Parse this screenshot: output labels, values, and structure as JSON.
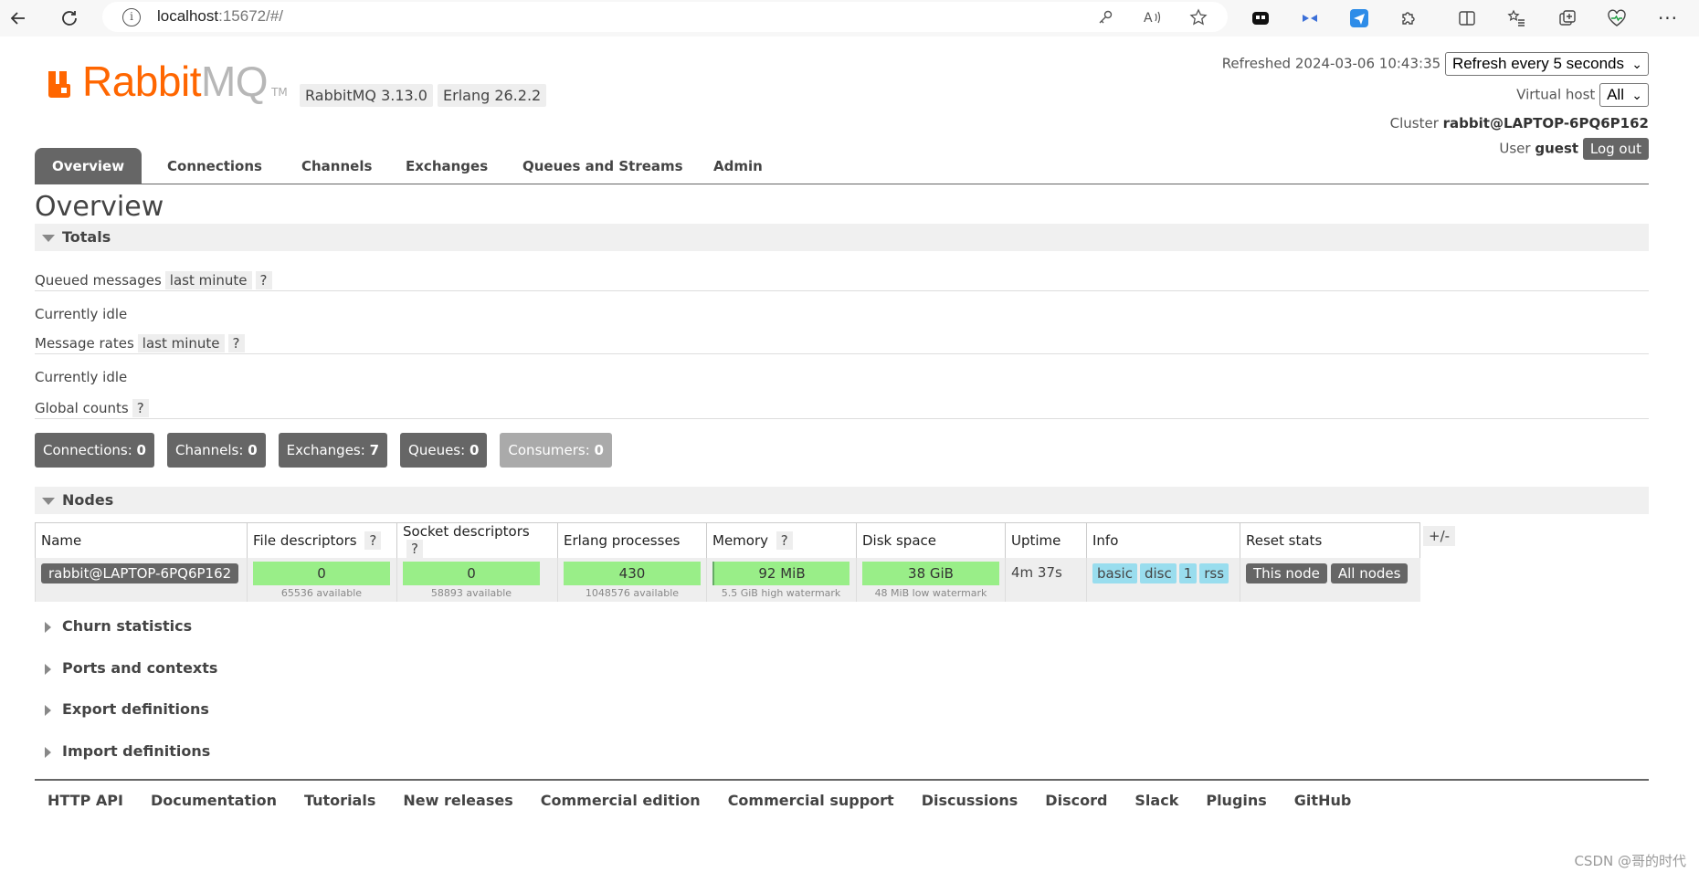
{
  "browser": {
    "url_host": "localhost",
    "url_rest": ":15672/#/"
  },
  "header": {
    "logo_rabbit": "Rabbit",
    "logo_mq": "MQ",
    "logo_tm": "TM",
    "version_rabbit": "RabbitMQ 3.13.0",
    "version_erlang": "Erlang 26.2.2",
    "refreshed_label": "Refreshed 2024-03-06 10:43:35",
    "refresh_select": "Refresh every 5 seconds",
    "vhost_label": "Virtual host",
    "vhost_select": "All",
    "cluster_label": "Cluster",
    "cluster_value": "rabbit@LAPTOP-6PQ6P162",
    "user_label": "User",
    "user_value": "guest",
    "logout": "Log out"
  },
  "tabs": [
    "Overview",
    "Connections",
    "Channels",
    "Exchanges",
    "Queues and Streams",
    "Admin"
  ],
  "page_title": "Overview",
  "totals": {
    "header": "Totals",
    "queued_label": "Queued messages",
    "queued_range": "last minute",
    "queued_hint": "?",
    "queued_status": "Currently idle",
    "rates_label": "Message rates",
    "rates_range": "last minute",
    "rates_hint": "?",
    "rates_status": "Currently idle",
    "global_label": "Global counts",
    "global_hint": "?"
  },
  "counts": {
    "connections_label": "Connections:",
    "connections": "0",
    "channels_label": "Channels:",
    "channels": "0",
    "exchanges_label": "Exchanges:",
    "exchanges": "7",
    "queues_label": "Queues:",
    "queues": "0",
    "consumers_label": "Consumers:",
    "consumers": "0"
  },
  "nodes": {
    "header": "Nodes",
    "columns": {
      "name": "Name",
      "fd": "File descriptors",
      "sd": "Socket descriptors",
      "ep": "Erlang processes",
      "mem": "Memory",
      "disk": "Disk space",
      "uptime": "Uptime",
      "info": "Info",
      "reset": "Reset stats",
      "hint": "?"
    },
    "plusminus": "+/-",
    "row": {
      "name": "rabbit@LAPTOP-6PQ6P162",
      "fd_value": "0",
      "fd_sub": "65536 available",
      "sd_value": "0",
      "sd_sub": "58893 available",
      "ep_value": "430",
      "ep_sub": "1048576 available",
      "mem_value": "92 MiB",
      "mem_sub": "5.5 GiB high watermark",
      "disk_value": "38 GiB",
      "disk_sub": "48 MiB low watermark",
      "uptime": "4m 37s",
      "info_tags": [
        "basic",
        "disc",
        "1",
        "rss"
      ],
      "reset_this": "This node",
      "reset_all": "All nodes"
    }
  },
  "collapsed_sections": [
    "Churn statistics",
    "Ports and contexts",
    "Export definitions",
    "Import definitions"
  ],
  "footer_links": [
    "HTTP API",
    "Documentation",
    "Tutorials",
    "New releases",
    "Commercial edition",
    "Commercial support",
    "Discussions",
    "Discord",
    "Slack",
    "Plugins",
    "GitHub"
  ],
  "watermark": "CSDN @哥的时代",
  "colors": {
    "brand_orange": "#ff6600",
    "tab_active": "#666666",
    "bar_green": "#99ee88",
    "tag_blue": "#99ddee"
  }
}
